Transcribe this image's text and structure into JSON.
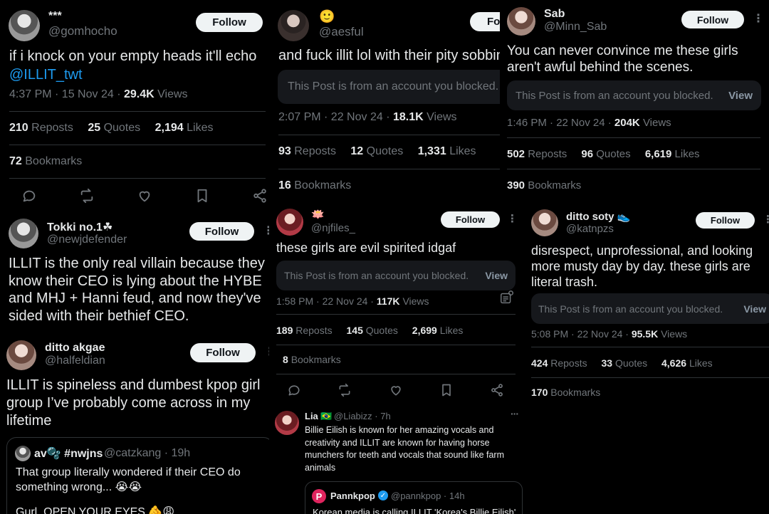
{
  "common": {
    "follow_label": "Follow",
    "views_word": "Views",
    "reposts_word": "Reposts",
    "quotes_word": "Quotes",
    "likes_word": "Likes",
    "bookmarks_word": "Bookmarks",
    "blocked_text": "This Post is from an account you blocked.",
    "view_label": "View",
    "more_symbol": "⋮"
  },
  "colors": {
    "background": "#000000",
    "text": "#e7e9ea",
    "muted": "#71767b",
    "link": "#1d9bf0",
    "divider": "#2f3336",
    "button": "#eff3f4"
  },
  "post1": {
    "name": "***",
    "handle": "@gomhocho",
    "text_line1": "if i knock on your empty heads it'll echo",
    "mention": "@ILLIT_twt",
    "time": "4:37 PM · 15 Nov 24 · ",
    "views": "29.4K",
    "reposts": "210",
    "quotes": "25",
    "likes": "2,194",
    "bookmarks": "72"
  },
  "post2": {
    "name": "🙂",
    "handle": "@aesful",
    "text": "and fuck illit lol with their pity sobbing",
    "time": "2:07 PM · 22 Nov 24 · ",
    "views": "18.1K",
    "reposts": "93",
    "quotes": "12",
    "likes": "1,331",
    "bookmarks": "16"
  },
  "post3": {
    "name": "Sab",
    "handle": "@Minn_Sab",
    "text_line1": "You can never convince me these girls",
    "text_line2": "aren't awful behind the scenes.",
    "time": "1:46 PM · 22 Nov 24 · ",
    "views": "204K",
    "reposts": "502",
    "quotes": "96",
    "likes": "6,619",
    "bookmarks": "390"
  },
  "post4": {
    "name": "Tokki no.1☘",
    "handle": "@newjdefender",
    "lines": [
      "ILLIT is the only real villain because they",
      "know their CEO is lying about the HYBE",
      "and MHJ + Hanni feud, and now they've",
      "sided with their bethief CEO."
    ]
  },
  "post5": {
    "name": "ditto akgae",
    "handle": "@halfeldian",
    "lines": [
      "ILLIT is spineless and dumbest kpop girl",
      "group I’ve probably come across in my",
      "lifetime"
    ],
    "quote": {
      "name": "av🫧 #nwjns",
      "handle": "@catzkang · 19h",
      "line1": "That group literally wondered if their CEO do",
      "line2": "something wrong... 😭😭",
      "line3": "Gurl, OPEN YOUR EYES 🫵😩"
    }
  },
  "post6": {
    "name": "🪷",
    "handle": "@njfiles_",
    "text": "these girls are evil spirited idgaf",
    "time": "1:58 PM · 22 Nov 24 · ",
    "views": "117K",
    "reposts": "189",
    "quotes": "145",
    "likes": "2,699",
    "bookmarks": "8"
  },
  "post7": {
    "name": "ditto soty 👟",
    "handle": "@katnpzs",
    "lines": [
      "disrespect, unprofessional, and looking",
      "more musty day by day. these girls are",
      "literal trash."
    ],
    "time": "5:08 PM · 22 Nov 24 · ",
    "views": "95.5K",
    "reposts": "424",
    "quotes": "33",
    "likes": "4,626",
    "bookmarks": "170"
  },
  "post8": {
    "name": "Lia 🇧🇷",
    "handle": "@Liabizz · 7h",
    "lines": [
      "Billie Eilish is known for her amazing vocals and",
      "creativity and ILLIT are known for having horse",
      "munchers for teeth and vocals that sound like farm",
      "animals"
    ],
    "quote": {
      "name": "Pannkpop",
      "handle": "@pannkpop · 14h",
      "text": "Korean media is calling ILLIT 'Korea's Billie Eilish'"
    }
  }
}
